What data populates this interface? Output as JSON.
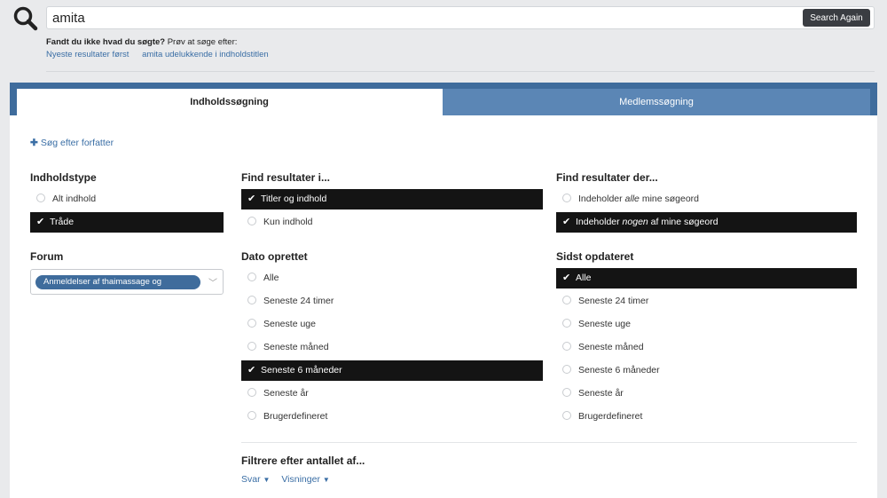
{
  "search": {
    "query": "amita",
    "button_label": "Search Again",
    "hint_bold": "Fandt du ikke hvad du søgte?",
    "hint_text": " Prøv at søge efter:",
    "hint_links": [
      "Nyeste resultater først",
      "amita udelukkende i indholdstitlen"
    ]
  },
  "tabs": [
    {
      "label": "Indholdssøgning",
      "active": true
    },
    {
      "label": "Medlemssøgning",
      "active": false
    }
  ],
  "add_author": "Søg efter forfatter",
  "content_type": {
    "heading": "Indholdstype",
    "options": [
      {
        "label": "Alt indhold",
        "selected": false
      },
      {
        "label": "Tråde",
        "selected": true
      }
    ]
  },
  "forum": {
    "heading": "Forum",
    "selected_tag": "Anmeldelser af thaimassage og"
  },
  "find_in": {
    "heading": "Find resultater i...",
    "options": [
      {
        "label": "Titler og indhold",
        "selected": true
      },
      {
        "label": "Kun indhold",
        "selected": false
      }
    ]
  },
  "date_created": {
    "heading": "Dato oprettet",
    "options": [
      {
        "label": "Alle",
        "selected": false
      },
      {
        "label": "Seneste 24 timer",
        "selected": false
      },
      {
        "label": "Seneste uge",
        "selected": false
      },
      {
        "label": "Seneste måned",
        "selected": false
      },
      {
        "label": "Seneste 6 måneder",
        "selected": true
      },
      {
        "label": "Seneste år",
        "selected": false
      },
      {
        "label": "Brugerdefineret",
        "selected": false
      }
    ]
  },
  "find_that": {
    "heading": "Find resultater der...",
    "options": [
      {
        "prefix": "Indeholder ",
        "em": "alle",
        "suffix": " mine søgeord",
        "selected": false
      },
      {
        "prefix": "Indeholder ",
        "em": "nogen",
        "suffix": " af mine søgeord",
        "selected": true
      }
    ]
  },
  "last_updated": {
    "heading": "Sidst opdateret",
    "options": [
      {
        "label": "Alle",
        "selected": true
      },
      {
        "label": "Seneste 24 timer",
        "selected": false
      },
      {
        "label": "Seneste uge",
        "selected": false
      },
      {
        "label": "Seneste måned",
        "selected": false
      },
      {
        "label": "Seneste 6 måneder",
        "selected": false
      },
      {
        "label": "Seneste år",
        "selected": false
      },
      {
        "label": "Brugerdefineret",
        "selected": false
      }
    ]
  },
  "filter": {
    "heading": "Filtrere efter antallet af...",
    "links": [
      "Svar",
      "Visninger"
    ]
  }
}
